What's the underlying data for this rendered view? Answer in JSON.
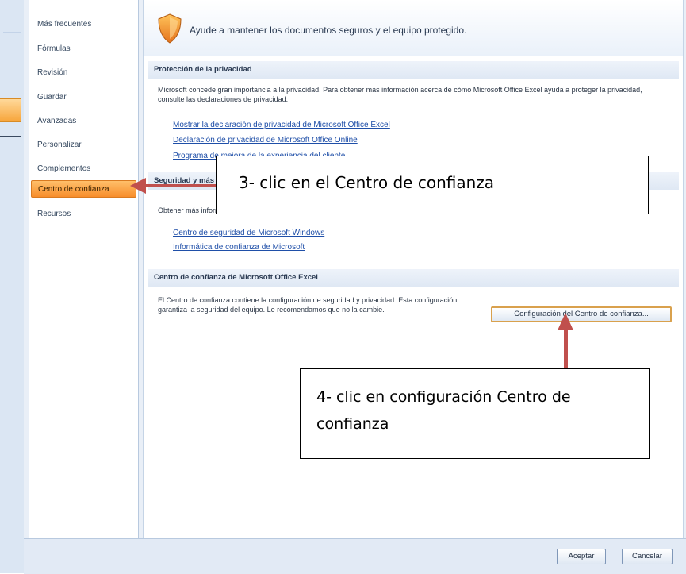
{
  "nav": {
    "items": [
      {
        "label": "Más frecuentes",
        "active": false
      },
      {
        "label": "Fórmulas",
        "active": false
      },
      {
        "label": "Revisión",
        "active": false
      },
      {
        "label": "Guardar",
        "active": false
      },
      {
        "label": "Avanzadas",
        "active": false
      },
      {
        "label": "Personalizar",
        "active": false
      },
      {
        "label": "Complementos",
        "active": false
      },
      {
        "label": "Centro de confianza",
        "active": true
      },
      {
        "label": "Recursos",
        "active": false
      }
    ]
  },
  "header": {
    "icon": "shield-icon",
    "text": "Ayude a mantener los documentos seguros y el equipo protegido."
  },
  "privacy": {
    "title": "Protección de la privacidad",
    "description": "Microsoft concede gran importancia a la privacidad. Para obtener más información acerca de cómo Microsoft Office Excel ayuda a proteger la privacidad, consulte las declaraciones de privacidad.",
    "links": [
      "Mostrar la declaración de privacidad de Microsoft Office Excel",
      "Declaración de privacidad de Microsoft Office Online",
      "Programa de mejora de la experiencia del cliente"
    ]
  },
  "security": {
    "title": "Seguridad y más",
    "description": "Obtener más información",
    "links": [
      "Centro de seguridad de Microsoft Windows",
      "Informática de confianza de Microsoft"
    ]
  },
  "trust_center": {
    "title": "Centro de confianza de Microsoft Office Excel",
    "description": "El Centro de confianza contiene la configuración de seguridad y privacidad. Esta configuración garantiza la seguridad del equipo. Le recomendamos que no la cambie.",
    "button_label": "Configuración del Centro de confianza..."
  },
  "footer": {
    "ok_label": "Aceptar",
    "cancel_label": "Cancelar"
  },
  "annotations": {
    "step3": "3- clic en el Centro de confianza",
    "step4": "4- clic en configuración Centro de confianza",
    "arrow_color": "#c0504d"
  }
}
